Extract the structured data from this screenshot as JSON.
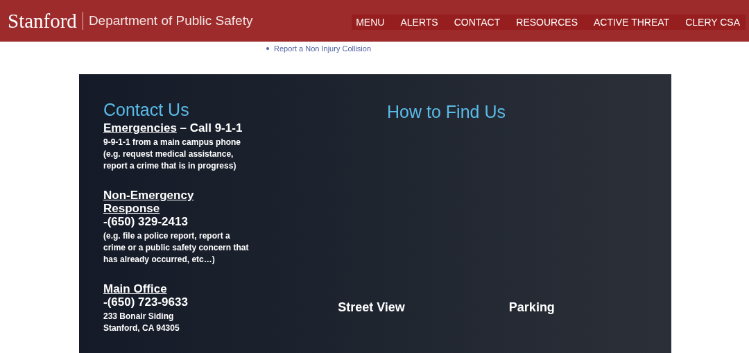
{
  "header": {
    "logo": "Stanford",
    "title": "Department of Public Safety",
    "nav": [
      "MENU",
      "ALERTS",
      "CONTACT",
      "RESOURCES",
      "ACTIVE THREAT",
      "CLERY CSA"
    ]
  },
  "links": [
    "Report a Non Injury Collision"
  ],
  "contact": {
    "title": "Contact Us",
    "sections": [
      {
        "heading": "Emergencies",
        "suffix": "– Call 9-1-1",
        "lines": [
          "9-9-1-1 from a main campus phone",
          "(e.g. request medical assistance, report a crime that is in progress)"
        ]
      },
      {
        "heading": "Non-Emergency Response",
        "phone": "-(650) 329-2413",
        "lines": [
          "(e.g. file a police report, report a crime or a public safety concern that has already occurred, etc…)"
        ]
      },
      {
        "heading": "Main Office",
        "phone": "-(650) 723-9633",
        "lines": [
          "233 Bonair Siding",
          "Stanford, CA 94305"
        ]
      }
    ]
  },
  "find": {
    "title": "How to Find Us",
    "links": [
      "Street View",
      "Parking"
    ]
  }
}
